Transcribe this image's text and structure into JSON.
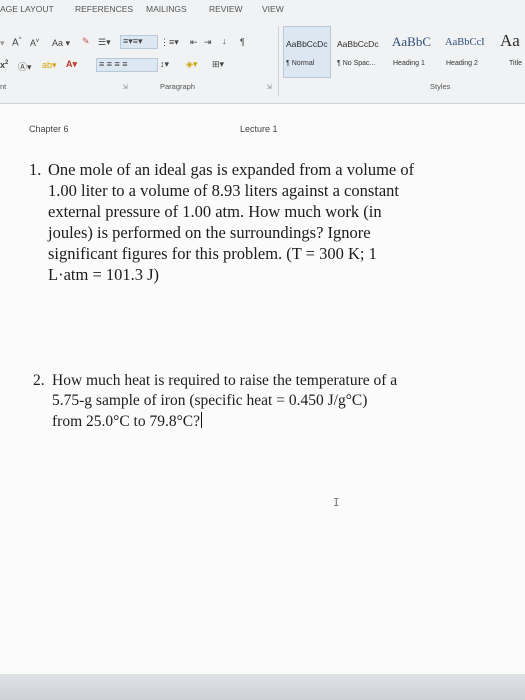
{
  "ribbon": {
    "tabs": [
      "AGE LAYOUT",
      "REFERENCES",
      "MAILINGS",
      "REVIEW",
      "VIEW"
    ],
    "font_group": {
      "grow_label": "A",
      "shrink_label": "A",
      "case_label": "Aa",
      "sub_label": "x",
      "font_color_label": "A"
    },
    "paragraph_label": "Paragraph",
    "styles_label": "Styles",
    "font_label_partial": "nt",
    "styles": [
      {
        "sample": "AaBbCcDc",
        "name": "¶ Normal"
      },
      {
        "sample": "AaBbCcDc",
        "name": "¶ No Spac..."
      },
      {
        "sample": "AaBbC",
        "name": "Heading 1"
      },
      {
        "sample": "AaBbCcI",
        "name": "Heading 2"
      },
      {
        "sample": "Aa",
        "name": "Title"
      }
    ]
  },
  "document": {
    "header_left": "Chapter 6",
    "header_center": "Lecture 1",
    "questions": [
      {
        "number": "1.",
        "lines": [
          "One mole of an ideal gas is expanded from a volume of",
          "1.00 liter to a volume of 8.93 liters against a constant",
          "external pressure of 1.00 atm. How much work (in",
          "joules) is performed on the surroundings? Ignore",
          "significant figures for this problem. (T = 300 K; 1",
          "L·atm = 101.3 J)"
        ]
      },
      {
        "number": "2.",
        "lines": [
          "How much heat is required to raise the temperature of a",
          "5.75-g sample of iron (specific heat = 0.450 J/g°C)",
          "from 25.0°C to 79.8°C?"
        ]
      }
    ]
  }
}
